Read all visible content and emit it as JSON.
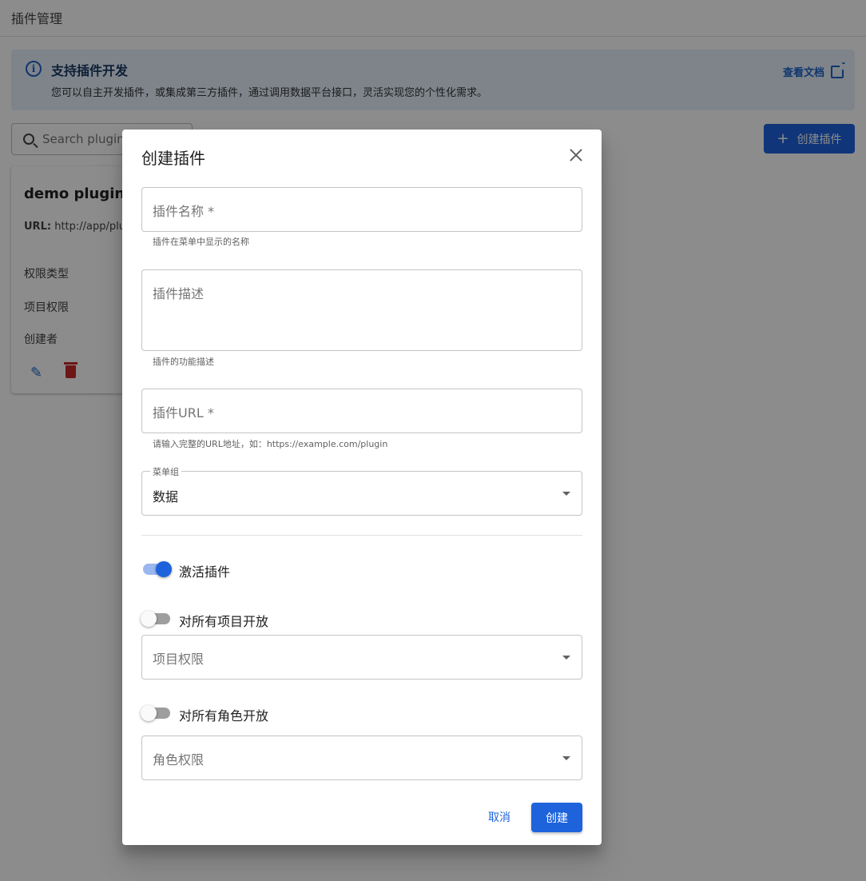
{
  "page": {
    "title": "插件管理",
    "banner": {
      "title": "支持插件开发",
      "description": "您可以自主开发插件，或集成第三方插件，通过调用数据平台接口，灵活实现您的个性化需求。",
      "docs_link": "查看文档"
    },
    "search": {
      "placeholder": "Search plugins"
    },
    "create_button": "创建插件",
    "card": {
      "title": "demo plugin",
      "url_label": "URL:",
      "url_value": "http://app/plugin",
      "rows": [
        "权限类型",
        "项目权限",
        "创建者"
      ]
    }
  },
  "dialog": {
    "title": "创建插件",
    "name_field": {
      "label": "插件名称 *",
      "helper": "插件在菜单中显示的名称"
    },
    "desc_field": {
      "label": "插件描述",
      "helper": "插件的功能描述"
    },
    "url_field": {
      "label": "插件URL *",
      "helper": "请输入完整的URL地址，如：https://example.com/plugin"
    },
    "menu_group": {
      "label": "菜单组",
      "value": "数据"
    },
    "activate_switch": {
      "label": "激活插件",
      "on": true
    },
    "all_projects_switch": {
      "label": "对所有项目开放",
      "on": false
    },
    "project_perm_select": {
      "label": "项目权限"
    },
    "all_roles_switch": {
      "label": "对所有角色开放",
      "on": false
    },
    "role_perm_select": {
      "label": "角色权限"
    },
    "cancel_button": "取消",
    "create_button": "创建"
  },
  "colors": {
    "primary": "#1e63dc",
    "banner_bg": "#e6f1fb",
    "delete": "#c62828"
  },
  "icons": [
    "info-icon",
    "external-link-icon",
    "search-icon",
    "plus-icon",
    "edit-icon",
    "delete-icon",
    "close-icon",
    "chevron-down-icon"
  ]
}
